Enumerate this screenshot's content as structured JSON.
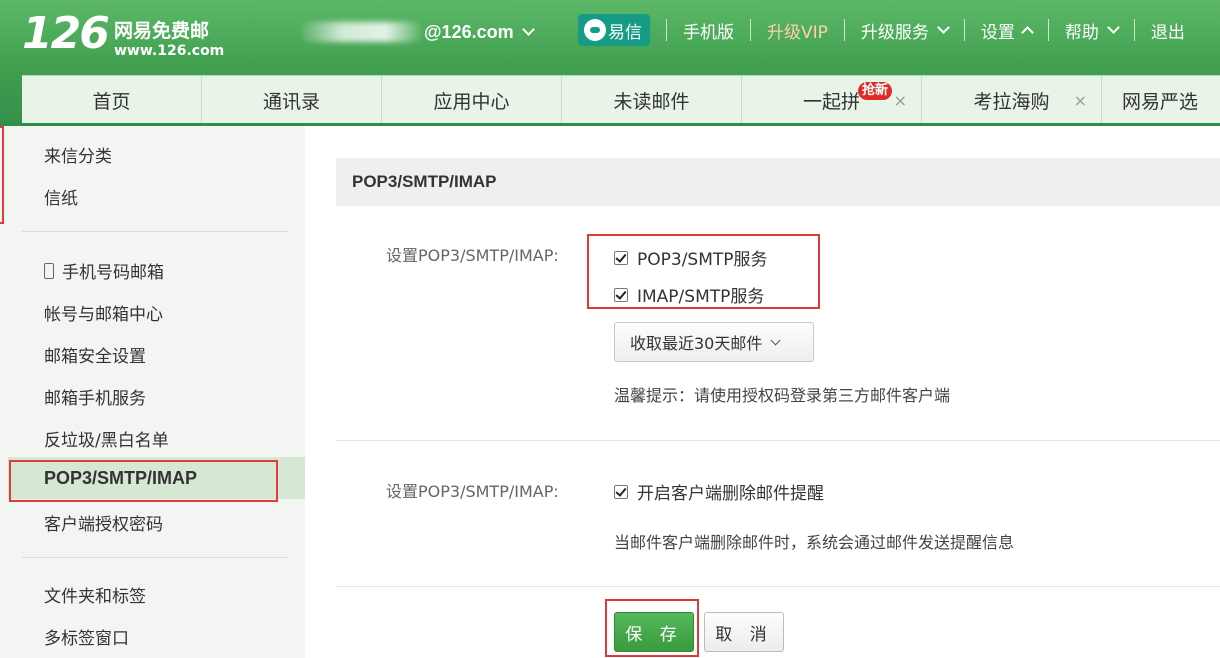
{
  "header": {
    "logo_number": "126",
    "logo_name": "网易免费邮",
    "logo_url": "www.126.com",
    "account_domain": "@126.com",
    "yixin_label": "易信",
    "links": {
      "mobile": "手机版",
      "vip": "升级VIP",
      "upgrade_service": "升级服务",
      "settings": "设置",
      "help": "帮助",
      "logout": "退出"
    }
  },
  "tabs": [
    {
      "label": "首页"
    },
    {
      "label": "通讯录"
    },
    {
      "label": "应用中心"
    },
    {
      "label": "未读邮件"
    },
    {
      "label": "一起拼",
      "badge": "抢新",
      "close": "×"
    },
    {
      "label": "考拉海购",
      "close": "×"
    },
    {
      "label": "网易严选"
    }
  ],
  "sidebar": {
    "items": [
      {
        "label": "来信分类"
      },
      {
        "label": "信纸"
      },
      {
        "label": "手机号码邮箱"
      },
      {
        "label": "帐号与邮箱中心"
      },
      {
        "label": "邮箱安全设置"
      },
      {
        "label": "邮箱手机服务"
      },
      {
        "label": "反垃圾/黑白名单"
      },
      {
        "label": "POP3/SMTP/IMAP"
      },
      {
        "label": "客户端授权密码"
      },
      {
        "label": "文件夹和标签"
      },
      {
        "label": "多标签窗口"
      }
    ]
  },
  "main": {
    "title": "POP3/SMTP/IMAP",
    "section1": {
      "label": "设置POP3/SMTP/IMAP:",
      "options": [
        {
          "label": "POP3/SMTP服务",
          "checked": true
        },
        {
          "label": "IMAP/SMTP服务",
          "checked": true
        }
      ],
      "select_value": "收取最近30天邮件",
      "tip": "温馨提示：请使用授权码登录第三方邮件客户端"
    },
    "section2": {
      "label": "设置POP3/SMTP/IMAP:",
      "option": {
        "label": "开启客户端删除邮件提醒",
        "checked": true
      },
      "description": "当邮件客户端删除邮件时，系统会通过邮件发送提醒信息"
    },
    "buttons": {
      "save": "保 存",
      "cancel": "取 消"
    }
  },
  "colors": {
    "brand_green": "#3f9f4e",
    "save_green": "#3a9a3e",
    "highlight_red": "#e03a3a"
  }
}
